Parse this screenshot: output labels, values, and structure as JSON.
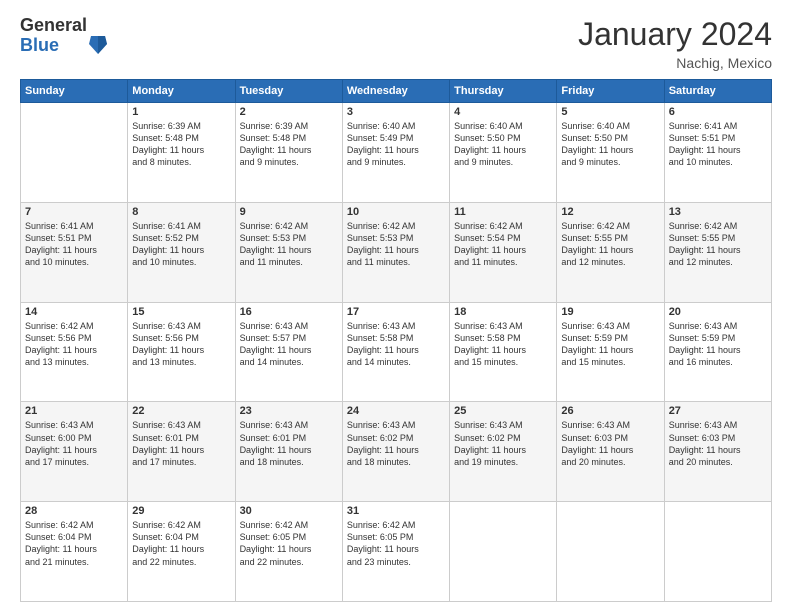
{
  "logo": {
    "general": "General",
    "blue": "Blue"
  },
  "title": "January 2024",
  "location": "Nachig, Mexico",
  "days": [
    "Sunday",
    "Monday",
    "Tuesday",
    "Wednesday",
    "Thursday",
    "Friday",
    "Saturday"
  ],
  "weeks": [
    [
      {
        "num": "",
        "info": ""
      },
      {
        "num": "1",
        "info": "Sunrise: 6:39 AM\nSunset: 5:48 PM\nDaylight: 11 hours\nand 8 minutes."
      },
      {
        "num": "2",
        "info": "Sunrise: 6:39 AM\nSunset: 5:48 PM\nDaylight: 11 hours\nand 9 minutes."
      },
      {
        "num": "3",
        "info": "Sunrise: 6:40 AM\nSunset: 5:49 PM\nDaylight: 11 hours\nand 9 minutes."
      },
      {
        "num": "4",
        "info": "Sunrise: 6:40 AM\nSunset: 5:50 PM\nDaylight: 11 hours\nand 9 minutes."
      },
      {
        "num": "5",
        "info": "Sunrise: 6:40 AM\nSunset: 5:50 PM\nDaylight: 11 hours\nand 9 minutes."
      },
      {
        "num": "6",
        "info": "Sunrise: 6:41 AM\nSunset: 5:51 PM\nDaylight: 11 hours\nand 10 minutes."
      }
    ],
    [
      {
        "num": "7",
        "info": "Sunrise: 6:41 AM\nSunset: 5:51 PM\nDaylight: 11 hours\nand 10 minutes."
      },
      {
        "num": "8",
        "info": "Sunrise: 6:41 AM\nSunset: 5:52 PM\nDaylight: 11 hours\nand 10 minutes."
      },
      {
        "num": "9",
        "info": "Sunrise: 6:42 AM\nSunset: 5:53 PM\nDaylight: 11 hours\nand 11 minutes."
      },
      {
        "num": "10",
        "info": "Sunrise: 6:42 AM\nSunset: 5:53 PM\nDaylight: 11 hours\nand 11 minutes."
      },
      {
        "num": "11",
        "info": "Sunrise: 6:42 AM\nSunset: 5:54 PM\nDaylight: 11 hours\nand 11 minutes."
      },
      {
        "num": "12",
        "info": "Sunrise: 6:42 AM\nSunset: 5:55 PM\nDaylight: 11 hours\nand 12 minutes."
      },
      {
        "num": "13",
        "info": "Sunrise: 6:42 AM\nSunset: 5:55 PM\nDaylight: 11 hours\nand 12 minutes."
      }
    ],
    [
      {
        "num": "14",
        "info": "Sunrise: 6:42 AM\nSunset: 5:56 PM\nDaylight: 11 hours\nand 13 minutes."
      },
      {
        "num": "15",
        "info": "Sunrise: 6:43 AM\nSunset: 5:56 PM\nDaylight: 11 hours\nand 13 minutes."
      },
      {
        "num": "16",
        "info": "Sunrise: 6:43 AM\nSunset: 5:57 PM\nDaylight: 11 hours\nand 14 minutes."
      },
      {
        "num": "17",
        "info": "Sunrise: 6:43 AM\nSunset: 5:58 PM\nDaylight: 11 hours\nand 14 minutes."
      },
      {
        "num": "18",
        "info": "Sunrise: 6:43 AM\nSunset: 5:58 PM\nDaylight: 11 hours\nand 15 minutes."
      },
      {
        "num": "19",
        "info": "Sunrise: 6:43 AM\nSunset: 5:59 PM\nDaylight: 11 hours\nand 15 minutes."
      },
      {
        "num": "20",
        "info": "Sunrise: 6:43 AM\nSunset: 5:59 PM\nDaylight: 11 hours\nand 16 minutes."
      }
    ],
    [
      {
        "num": "21",
        "info": "Sunrise: 6:43 AM\nSunset: 6:00 PM\nDaylight: 11 hours\nand 17 minutes."
      },
      {
        "num": "22",
        "info": "Sunrise: 6:43 AM\nSunset: 6:01 PM\nDaylight: 11 hours\nand 17 minutes."
      },
      {
        "num": "23",
        "info": "Sunrise: 6:43 AM\nSunset: 6:01 PM\nDaylight: 11 hours\nand 18 minutes."
      },
      {
        "num": "24",
        "info": "Sunrise: 6:43 AM\nSunset: 6:02 PM\nDaylight: 11 hours\nand 18 minutes."
      },
      {
        "num": "25",
        "info": "Sunrise: 6:43 AM\nSunset: 6:02 PM\nDaylight: 11 hours\nand 19 minutes."
      },
      {
        "num": "26",
        "info": "Sunrise: 6:43 AM\nSunset: 6:03 PM\nDaylight: 11 hours\nand 20 minutes."
      },
      {
        "num": "27",
        "info": "Sunrise: 6:43 AM\nSunset: 6:03 PM\nDaylight: 11 hours\nand 20 minutes."
      }
    ],
    [
      {
        "num": "28",
        "info": "Sunrise: 6:42 AM\nSunset: 6:04 PM\nDaylight: 11 hours\nand 21 minutes."
      },
      {
        "num": "29",
        "info": "Sunrise: 6:42 AM\nSunset: 6:04 PM\nDaylight: 11 hours\nand 22 minutes."
      },
      {
        "num": "30",
        "info": "Sunrise: 6:42 AM\nSunset: 6:05 PM\nDaylight: 11 hours\nand 22 minutes."
      },
      {
        "num": "31",
        "info": "Sunrise: 6:42 AM\nSunset: 6:05 PM\nDaylight: 11 hours\nand 23 minutes."
      },
      {
        "num": "",
        "info": ""
      },
      {
        "num": "",
        "info": ""
      },
      {
        "num": "",
        "info": ""
      }
    ]
  ]
}
